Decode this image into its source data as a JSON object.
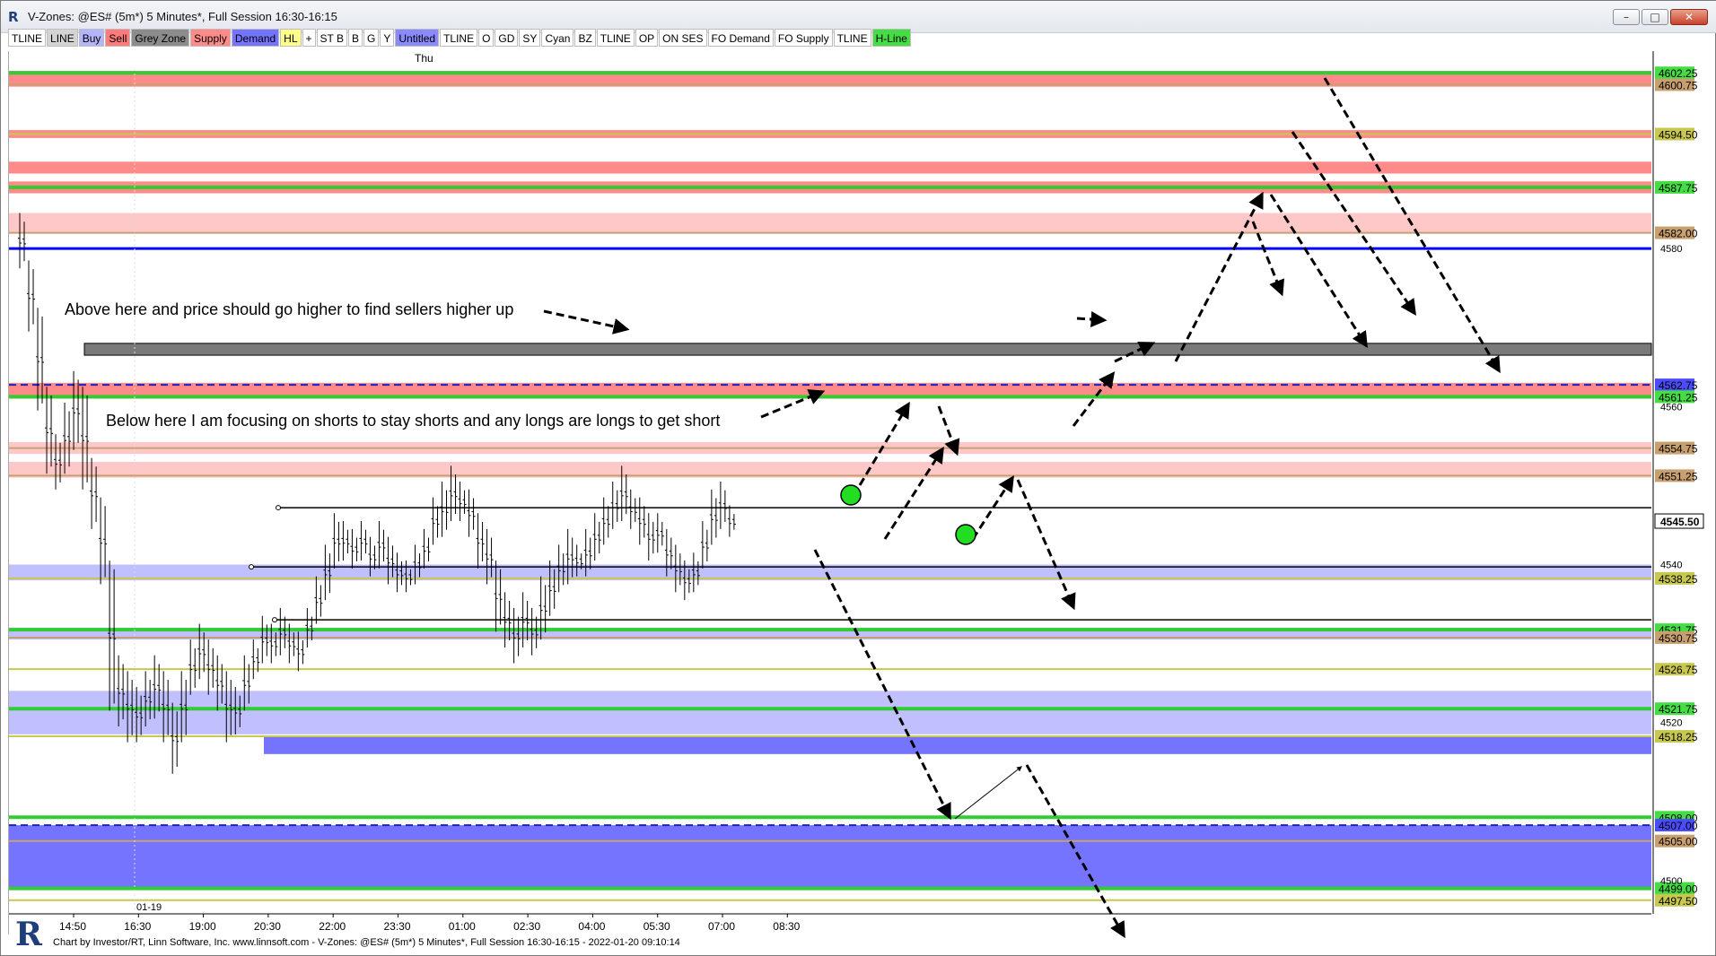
{
  "window": {
    "title": "V-Zones: @ES# (5m*) 5 Minutes*, Full Session 16:30-16:15",
    "app_icon": "investor-rt-icon",
    "controls": [
      "minimize-icon",
      "restore-icon",
      "close-icon"
    ]
  },
  "toolbar": [
    {
      "label": "TLINE",
      "bg": "#ffffff"
    },
    {
      "label": "LINE",
      "bg": "#d4d4d4"
    },
    {
      "label": "Buy",
      "bg": "#b4b4ff"
    },
    {
      "label": "Sell",
      "bg": "#ff7a7a"
    },
    {
      "label": "Grey Zone",
      "bg": "#8c8c8c"
    },
    {
      "label": "Supply",
      "bg": "#ff8a8a"
    },
    {
      "label": "Demand",
      "bg": "#7474ff"
    },
    {
      "label": "HL",
      "bg": "#ffff8a"
    },
    {
      "label": "+",
      "bg": "#ffffff"
    },
    {
      "label": "ST B",
      "bg": "#ffffff"
    },
    {
      "label": "B",
      "bg": "#ffffff"
    },
    {
      "label": "G",
      "bg": "#ffffff"
    },
    {
      "label": "Y",
      "bg": "#ffffff"
    },
    {
      "label": "Untitled",
      "bg": "#8a8aff"
    },
    {
      "label": "TLINE",
      "bg": "#ffffff"
    },
    {
      "label": "O",
      "bg": "#ffffff"
    },
    {
      "label": "GD",
      "bg": "#ffffff"
    },
    {
      "label": "SY",
      "bg": "#ffffff"
    },
    {
      "label": "Cyan",
      "bg": "#ffffff"
    },
    {
      "label": "BZ",
      "bg": "#ffffff"
    },
    {
      "label": "TLINE",
      "bg": "#ffffff"
    },
    {
      "label": "OP",
      "bg": "#ffffff"
    },
    {
      "label": "ON SES",
      "bg": "#ffffff"
    },
    {
      "label": "FO Demand",
      "bg": "#ffffff"
    },
    {
      "label": "FO Supply",
      "bg": "#ffffff"
    },
    {
      "label": "TLINE",
      "bg": "#ffffff"
    },
    {
      "label": "H-Line",
      "bg": "#44dd44"
    }
  ],
  "chart_data": {
    "type": "candlestick",
    "symbol": "@ES#",
    "timeframe": "5 Minutes",
    "day_label": "Thu",
    "date_label": "01-19",
    "x_ticks": [
      "14:50",
      "16:30",
      "19:00",
      "20:30",
      "22:00",
      "23:30",
      "01:00",
      "02:30",
      "04:00",
      "05:30",
      "07:00",
      "08:30"
    ],
    "y_range": [
      4496,
      4605
    ],
    "y_ticks": [
      "4580",
      "4560",
      "4540",
      "4520",
      "4500"
    ],
    "last_price": "4545.50",
    "price_levels": [
      {
        "label": "4602.25",
        "color": "#44dd44"
      },
      {
        "label": "4600.75",
        "color": "#c8a070"
      },
      {
        "label": "4594.50",
        "color": "#c8c850"
      },
      {
        "label": "4587.75",
        "color": "#44dd44"
      },
      {
        "label": "4582.00",
        "color": "#c8a070"
      },
      {
        "label": "4562.75",
        "color": "#4c4cff"
      },
      {
        "label": "4561.25",
        "color": "#44dd44"
      },
      {
        "label": "4554.75",
        "color": "#c8a070"
      },
      {
        "label": "4551.25",
        "color": "#c8a070"
      },
      {
        "label": "4538.25",
        "color": "#c8c850"
      },
      {
        "label": "4531.75",
        "color": "#44dd44"
      },
      {
        "label": "4530.75",
        "color": "#c8a070"
      },
      {
        "label": "4526.75",
        "color": "#c8c850"
      },
      {
        "label": "4521.75",
        "color": "#44dd44"
      },
      {
        "label": "4518.25",
        "color": "#c8c850"
      },
      {
        "label": "4508.00",
        "color": "#44dd44"
      },
      {
        "label": "4507.00",
        "color": "#4c4cff"
      },
      {
        "label": "4505.00",
        "color": "#c8a070"
      },
      {
        "label": "4499.00",
        "color": "#44dd44"
      },
      {
        "label": "4497.50",
        "color": "#c8c850"
      }
    ],
    "zones": [
      {
        "type": "supply",
        "from": 4600.5,
        "to": 4602.5
      },
      {
        "type": "supply",
        "from": 4594,
        "to": 4595
      },
      {
        "type": "supply",
        "from": 4589.5,
        "to": 4591
      },
      {
        "type": "supply",
        "from": 4587,
        "to": 4588.5
      },
      {
        "type": "supply-light",
        "from": 4582,
        "to": 4584.5
      },
      {
        "type": "grey",
        "from": 4566.5,
        "to": 4568
      },
      {
        "type": "supply",
        "from": 4561,
        "to": 4563
      },
      {
        "type": "supply-light",
        "from": 4554,
        "to": 4555.5
      },
      {
        "type": "supply-light",
        "from": 4551,
        "to": 4553
      },
      {
        "type": "demand-light",
        "from": 4538,
        "to": 4540
      },
      {
        "type": "demand-light",
        "from": 4530.5,
        "to": 4532
      },
      {
        "type": "demand-light",
        "from": 4518.5,
        "to": 4524
      },
      {
        "type": "demand",
        "from": 4516,
        "to": 4518.2
      },
      {
        "type": "demand",
        "from": 4499,
        "to": 4507
      }
    ]
  },
  "annotations": {
    "above_note": "Above here and price should go higher to find sellers higher up",
    "below_note": "Below here I am focusing on shorts to stay shorts and any longs are longs to get short"
  },
  "status": {
    "text": "Chart by Investor/RT, Linn Software, Inc. www.linnsoft.com - V-Zones: @ES# (5m*) 5 Minutes*, Full Session 16:30-16:15 - 2022-01-20 09:10:14",
    "logo": "R"
  },
  "colors": {
    "supply": "#ff8a8a",
    "supply_light": "#ffc8c8",
    "demand": "#7474ff",
    "demand_light": "#c0c0ff",
    "grey": "#7a7a7a",
    "green_line": "#33cc33",
    "blue_line": "#0000ff"
  }
}
